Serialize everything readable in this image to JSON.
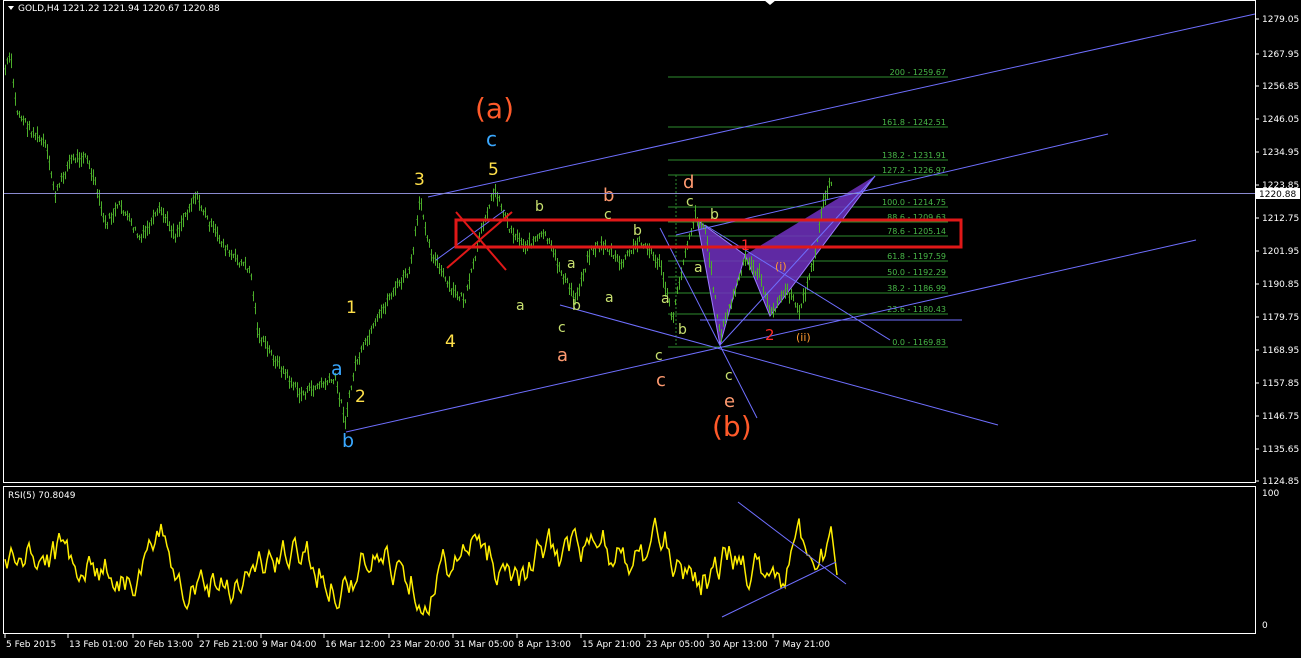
{
  "header": {
    "symbol_line": "GOLD,H4  1221.22 1221.94 1220.67 1220.88",
    "rsi_line": "RSI(5) 70.8049"
  },
  "price_axis": {
    "labels": [
      "1279.05",
      "1267.95",
      "1256.85",
      "1246.05",
      "1234.95",
      "1223.85",
      "1212.75",
      "1201.95",
      "1190.85",
      "1179.75",
      "1168.95",
      "1157.85",
      "1146.75",
      "1135.65",
      "1124.85"
    ],
    "current_price": "1220.88"
  },
  "rsi_axis": {
    "labels": [
      "100",
      "0"
    ]
  },
  "time_axis": {
    "labels": [
      "5 Feb 2015",
      "13 Feb 01:00",
      "20 Feb 13:00",
      "27 Feb 21:00",
      "9 Mar 04:00",
      "16 Mar 12:00",
      "23 Mar 20:00",
      "31 Mar 05:00",
      "8 Apr 13:00",
      "15 Apr 21:00",
      "23 Apr 05:00",
      "30 Apr 13:00",
      "7 May 21:00"
    ]
  },
  "fib_levels": [
    {
      "text": "200 - 1259.67"
    },
    {
      "text": "161.8 - 1242.51"
    },
    {
      "text": "138.2 - 1231.91"
    },
    {
      "text": "127.2 - 1226.97"
    },
    {
      "text": "100.0 - 1214.75"
    },
    {
      "text": "88.6 - 1209.63"
    },
    {
      "text": "78.6 - 1205.14"
    },
    {
      "text": "61.8 - 1197.59"
    },
    {
      "text": "50.0 - 1192.29"
    },
    {
      "text": "38.2 - 1186.99"
    },
    {
      "text": "23.6 - 1180.43"
    },
    {
      "text": "0.0 - 1169.83"
    }
  ],
  "wave_labels": [
    {
      "text": "(a)",
      "color": "#ff5a2a"
    },
    {
      "text": "c",
      "color": "#3aa8ff"
    },
    {
      "text": "5",
      "color": "#ffe04a"
    },
    {
      "text": "3",
      "color": "#ffe04a"
    },
    {
      "text": "1",
      "color": "#ffe04a"
    },
    {
      "text": "4",
      "color": "#ffe04a"
    },
    {
      "text": "2",
      "color": "#ffe04a"
    },
    {
      "text": "a",
      "color": "#3aa8ff"
    },
    {
      "text": "b",
      "color": "#3aa8ff"
    },
    {
      "text": "b",
      "color": "#c8e070"
    },
    {
      "text": "a",
      "color": "#c8e070"
    },
    {
      "text": "a",
      "color": "#c8e070"
    },
    {
      "text": "b",
      "color": "#c8e070"
    },
    {
      "text": "c",
      "color": "#c8e070"
    },
    {
      "text": "a",
      "color": "#ff9a70"
    },
    {
      "text": "b",
      "color": "#ff9a70"
    },
    {
      "text": "c",
      "color": "#c8e070"
    },
    {
      "text": "a",
      "color": "#c8e070"
    },
    {
      "text": "b",
      "color": "#c8e070"
    },
    {
      "text": "a",
      "color": "#c8e070"
    },
    {
      "text": "b",
      "color": "#c8e070"
    },
    {
      "text": "c",
      "color": "#c8e070"
    },
    {
      "text": "c",
      "color": "#ff9a70"
    },
    {
      "text": "d",
      "color": "#ff9a70"
    },
    {
      "text": "c",
      "color": "#c8e070"
    },
    {
      "text": "b",
      "color": "#c8e070"
    },
    {
      "text": "a",
      "color": "#c8e070"
    },
    {
      "text": "c",
      "color": "#c8e070"
    },
    {
      "text": "e",
      "color": "#ff9a70"
    },
    {
      "text": "(b)",
      "color": "#ff5a2a"
    },
    {
      "text": "1",
      "color": "#ff2a2a"
    },
    {
      "text": "2",
      "color": "#ff2a2a"
    },
    {
      "text": "(i)",
      "color": "#ff9a30"
    },
    {
      "text": "(ii)",
      "color": "#ff9a30"
    }
  ],
  "colors": {
    "background": "#000000",
    "candles": "#4caf2a",
    "trendlines": "#6f6fff",
    "fib": "#2e8b2e",
    "box": "#e01818",
    "pattern": "#7030c0",
    "rsi_line": "#ffee00"
  }
}
